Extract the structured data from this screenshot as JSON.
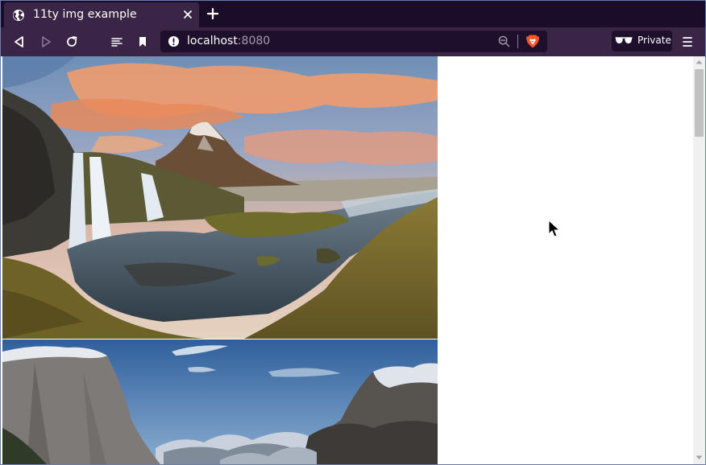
{
  "browser": {
    "tab": {
      "title": "11ty img example",
      "favicon": "globe-icon",
      "close_icon": "close-icon"
    },
    "new_tab_icon": "plus-icon",
    "toolbar": {
      "back_icon": "back-icon",
      "forward_icon": "forward-icon",
      "reload_icon": "reload-icon",
      "reader_icon": "reader-mode-icon",
      "bookmark_icon": "bookmark-icon"
    },
    "address": {
      "host": "localhost",
      "port": ":8080",
      "info_icon": "info-icon",
      "zoom_icon": "zoom-out-icon",
      "shields_icon": "brave-shields-icon"
    },
    "private_label": "Private",
    "private_icon": "private-glasses-icon",
    "menu_icon": "hamburger-menu-icon"
  },
  "colors": {
    "tabstrip_bg": "#1b0d2a",
    "toolbar_bg": "#3b2547",
    "url_bg": "#1e0f2d",
    "brave_orange": "#fb542b",
    "page_bg": "#ffffff"
  },
  "page": {
    "images": [
      {
        "name": "waterfall-mountain-image"
      },
      {
        "name": "granite-cliff-valley-image"
      }
    ]
  }
}
